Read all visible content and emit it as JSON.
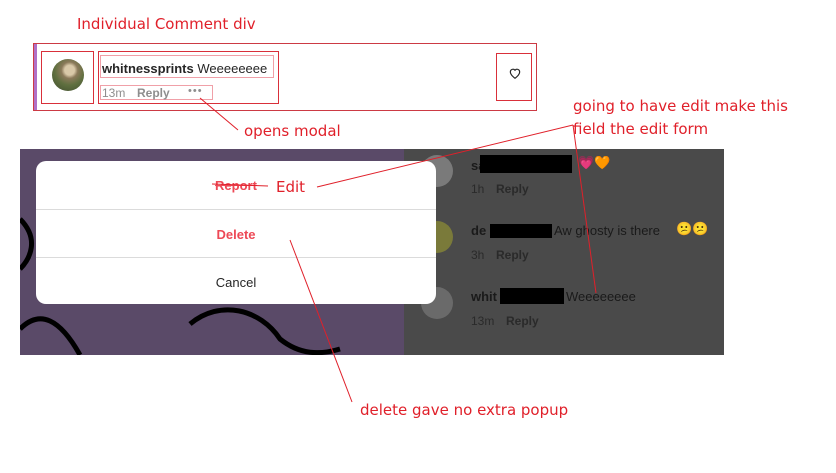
{
  "annotations": {
    "title": "Individual Comment div",
    "opens_modal": "opens modal",
    "edit_note_line1": "going to have edit make this",
    "edit_note_line2": "field the edit form",
    "edit_label": "Edit",
    "delete_note": "delete gave no extra popup"
  },
  "comment": {
    "username": "whitnessprints",
    "text": "Weeeeeeee",
    "time": "13m",
    "reply": "Reply",
    "more": "•••"
  },
  "modal": {
    "report": "Report",
    "delete": "Delete",
    "cancel": "Cancel"
  },
  "background_comments": [
    {
      "username": "sa",
      "text": "",
      "emoji": "💗🧡",
      "time": "1h",
      "reply": "Reply"
    },
    {
      "username": "de",
      "text": "Aw ghosty is there",
      "emoji": "😕😕",
      "time": "3h",
      "reply": "Reply"
    },
    {
      "username": "whit",
      "text": "Weeeeeeee",
      "emoji": "",
      "time": "13m",
      "reply": "Reply"
    }
  ],
  "colors": {
    "annotation_red": "#e0202a",
    "modal_red": "#ed4956",
    "overlay_gray": "#4a4a4a",
    "background_purple": "#5a4a68"
  }
}
